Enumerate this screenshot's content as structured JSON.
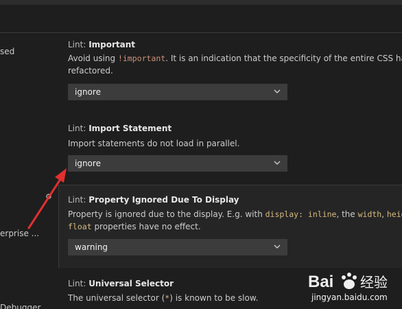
{
  "left_panel": {
    "line1": "sed",
    "line2": "erprise ...",
    "line3": "Debugger"
  },
  "settings": [
    {
      "category": "Lint: ",
      "name": "Important",
      "description_parts": [
        "Avoid using ",
        "!important",
        ". It is an indication that the specificity of the entire CSS has g"
      ],
      "description_line2": "refactored.",
      "value": "ignore"
    },
    {
      "category": "Lint: ",
      "name": "Import Statement",
      "description": "Import statements do not load in parallel.",
      "value": "ignore"
    },
    {
      "category": "Lint: ",
      "name": "Property Ignored Due To Display",
      "description_parts": [
        "Property is ignored due to the display. E.g. with ",
        "display: inline",
        ", the ",
        "width",
        ", ",
        "heigh"
      ],
      "description_line2_parts": [
        "float",
        " properties have no effect."
      ],
      "value": "warning"
    },
    {
      "category": "Lint: ",
      "name": "Universal Selector",
      "description_parts": [
        "The universal selector (",
        "*",
        ") is known to be slow."
      ]
    }
  ],
  "watermark": {
    "brand": "Bai",
    "brand_suffix": "经验",
    "url": "jingyan.baidu.com"
  },
  "colors": {
    "background": "#1e1e1e",
    "focused_background": "#252526",
    "dropdown_background": "#3c3c3c",
    "code_color": "#d7ba7d",
    "arrow_color": "#e0302f"
  }
}
